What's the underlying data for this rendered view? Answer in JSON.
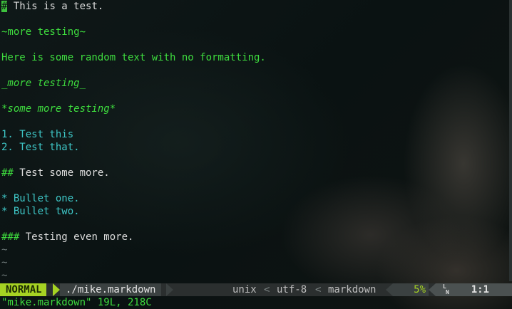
{
  "buffer": {
    "lines": [
      {
        "cursor_char": "#",
        "rest": " This is a test."
      },
      {
        "text": ""
      },
      {
        "text": "~more testing~"
      },
      {
        "text": ""
      },
      {
        "text": "Here is some random text with no formatting."
      },
      {
        "text": ""
      },
      {
        "text": "_more testing_"
      },
      {
        "text": ""
      },
      {
        "text": "*some more testing*"
      },
      {
        "text": ""
      },
      {
        "marker": "1.",
        "text": " Test this"
      },
      {
        "marker": "2.",
        "text": " Test that."
      },
      {
        "text": ""
      },
      {
        "marker": "##",
        "text": " Test some more."
      },
      {
        "text": ""
      },
      {
        "marker": "*",
        "text": " Bullet one."
      },
      {
        "marker": "*",
        "text": " Bullet two."
      },
      {
        "text": ""
      },
      {
        "marker": "###",
        "text": " Testing even more."
      }
    ],
    "tildes": [
      "~",
      "~",
      "~"
    ]
  },
  "statusline": {
    "mode": "NORMAL",
    "file": "./mike.markdown",
    "fileformat": "unix",
    "encoding": "utf-8",
    "filetype": "markdown",
    "sep_char": "<",
    "percent": "5%",
    "ln_icon_top": "L",
    "ln_icon_bottom": "N",
    "position": "1:1"
  },
  "cmdline": {
    "message": "\"mike.markdown\" 19L, 218C"
  },
  "colors": {
    "mode_bg": "#a6d323",
    "text_green": "#3edc3e",
    "text_cyan": "#3ec7c7",
    "statusbar_bg": "#2b2f2f"
  }
}
